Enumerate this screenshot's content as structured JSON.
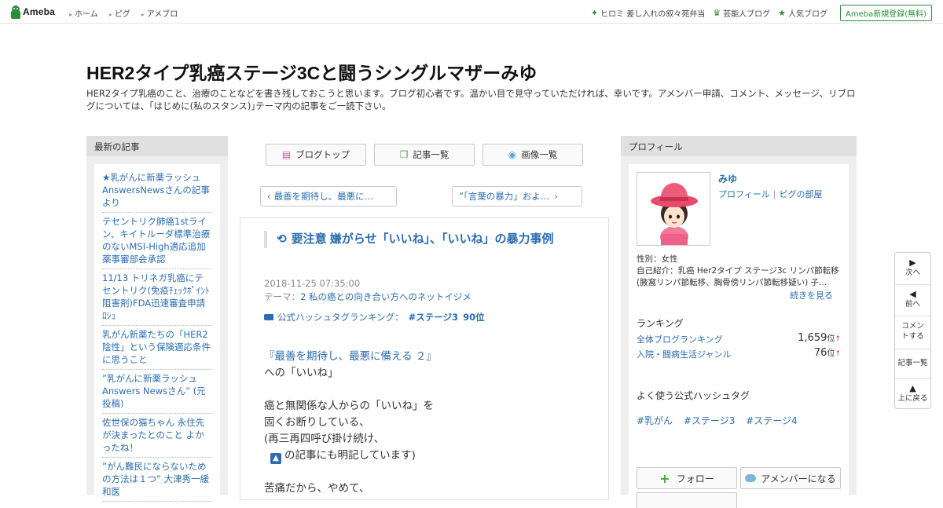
{
  "header": {
    "logo": "Ameba",
    "nav": [
      "ホーム",
      "ピグ",
      "アメブロ"
    ],
    "right_items": [
      {
        "icon": "sparkle-icon",
        "label": "ヒロミ 差し入れの叙々苑弁当"
      },
      {
        "icon": "crown-icon",
        "label": "芸能人ブログ"
      },
      {
        "icon": "star-icon",
        "label": "人気ブログ"
      }
    ],
    "register": "Ameba新規登録(無料)"
  },
  "blog": {
    "title": "HER2タイプ乳癌ステージ3Cと闘うシングルマザーみゆ",
    "description": "HER2タイプ乳癌のこと、治療のことなどを書き残しておこうと思います。ブログ初心者です。温かい目で見守っていただければ、幸いです。アメンバー申請、コメント、メッセージ、リブログについては、｢はじめに(私のスタンス)｣テーマ内の記事をご一読下さい。"
  },
  "left": {
    "heading": "最新の記事",
    "recent": [
      "★乳がんに新薬ラッシュ AnswersNewsさんの記事より",
      "テセントリク肺癌1stライン、キイトルーダ標準治療のないMSI-High適応追加 薬事審部会承認",
      "11/13 トリネガ乳癌にテセントリク(免疫ﾁｪｯｸﾎﾟｲﾝﾄ阻害剤)FDA迅速審査申請 ﾛｼｭ",
      "乳がん新薬たちの「HER2陰性」という保険適応条件 に思うこと",
      "”乳がんに新薬ラッシュ Answers Newsさん” (元投稿)",
      "佐世保の猫ちゃん 永住先が決まったとのこと よかったね！",
      "”がん難民にならないための方法は１つ” 大津秀一緩和医"
    ]
  },
  "center": {
    "tabs": [
      {
        "icon": "document-icon",
        "label": "ブログトップ"
      },
      {
        "icon": "copy-icon",
        "label": "記事一覧"
      },
      {
        "icon": "camera-icon",
        "label": "画像一覧"
      }
    ],
    "prev": "最善を期待し、最悪に…",
    "next": "”「言葉の暴力」およ…",
    "article": {
      "title": "要注意 嫌がらせ「いいね」、「いいね」の暴力事例",
      "date": "2018-11-25 07:35:00",
      "theme_label": "テーマ：",
      "theme": "2 私の癌との向き合い方へのネットイジメ",
      "hashtag_label": "公式ハッシュタグランキング：",
      "hashtag": "#ステージ3",
      "hashtag_rank": "90位",
      "body": {
        "line1": "『最善を期待し、最悪に備える ２』",
        "line2": "への「いいね」",
        "line3": "癌と無関係な人からの「いいね」を",
        "line4": "固くお断りしている、",
        "line5": "(再三再四呼び掛け続け、",
        "line6": "の記事にも明記しています)",
        "line7": "苦痛だから、やめて、"
      }
    }
  },
  "right": {
    "heading": "プロフィール",
    "name": "みゆ",
    "profile_link": "プロフィール",
    "pig_link": "ピグの部屋",
    "gender": "性別：女性",
    "intro": "自己紹介：乳癌 Her2タイプ ステージ3c リンパ節転移 (腋窩リンパ節転移、胸骨傍リンパ節転移疑い) 子...",
    "see_more": "続きを見る",
    "ranking_heading": "ランキング",
    "rankings": [
      {
        "label": "全体ブログランキング",
        "value": "1,659",
        "unit": "位"
      },
      {
        "label": "入院・闘病生活ジャンル",
        "value": "76",
        "unit": "位"
      }
    ],
    "hashtag_heading": "よく使う公式ハッシュタグ",
    "hashtags": [
      "#乳がん",
      "#ステージ3",
      "#ステージ4"
    ],
    "follow": "フォロー",
    "member": "アメンバーになる"
  },
  "floatnav": {
    "next": "次へ",
    "prev": "前へ",
    "comment": "コメントする",
    "list": "記事一覧",
    "top": "上に戻る"
  },
  "colors": {
    "link": "#2a6db0",
    "brand": "#2d8c3c"
  }
}
